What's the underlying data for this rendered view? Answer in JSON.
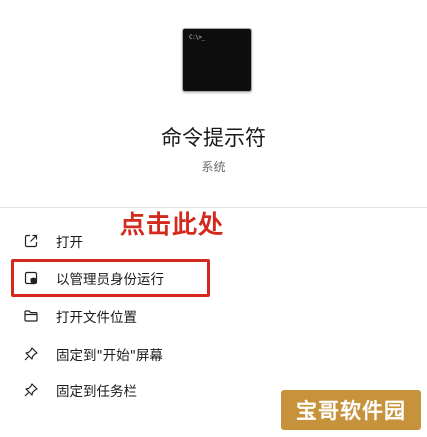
{
  "app": {
    "prompt_text": "C:\\>_",
    "name": "命令提示符",
    "category": "系统"
  },
  "annotation": "点击此处",
  "menu": [
    {
      "label": "打开",
      "icon": "open-external-icon"
    },
    {
      "label": "以管理员身份运行",
      "icon": "shield-admin-icon",
      "highlighted": true
    },
    {
      "label": "打开文件位置",
      "icon": "folder-icon"
    },
    {
      "label": "固定到\"开始\"屏幕",
      "icon": "pin-icon"
    },
    {
      "label": "固定到任务栏",
      "icon": "pin-icon"
    }
  ],
  "watermark": "宝哥软件园",
  "colors": {
    "annotation": "#d42a1e",
    "watermark": "#c6933c"
  }
}
